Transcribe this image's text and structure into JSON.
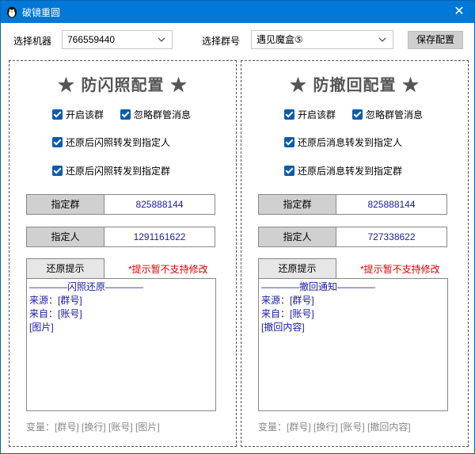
{
  "window": {
    "title": "破镜重圆",
    "close_glyph": "✕"
  },
  "toolbar": {
    "machine_label": "选择机器",
    "machine_value": "766559440",
    "group_label": "选择群号",
    "group_value": "遇见魔盒⑤",
    "save_label": "保存配置"
  },
  "left_panel": {
    "title": "★ 防闪照配置 ★",
    "checkboxes": {
      "enable": "开启该群",
      "ignore_admin": "忽略群管消息",
      "forward_person": "还原后闪照转发到指定人",
      "forward_group": "还原后闪照转发到指定群"
    },
    "target_group_label": "指定群",
    "target_group_value": "825888144",
    "target_person_label": "指定人",
    "target_person_value": "1291161622",
    "tip_label": "还原提示",
    "warning": "*提示暂不支持修改",
    "template": "————闪照还原————\n来源：[群号]\n来自：[账号]\n[图片]",
    "variables": "变量：[群号] [换行] [账号] [图片]"
  },
  "right_panel": {
    "title": "★ 防撤回配置 ★",
    "checkboxes": {
      "enable": "开启该群",
      "ignore_admin": "忽略群管消息",
      "forward_person": "还原后消息转发到指定人",
      "forward_group": "还原后消息转发到指定群"
    },
    "target_group_label": "指定群",
    "target_group_value": "825888144",
    "target_person_label": "指定人",
    "target_person_value": "727338622",
    "tip_label": "还原提示",
    "warning": "*提示暂不支持修改",
    "template": "————撤回通知————\n来源：[群号]\n来自：[账号]\n[撤回内容]",
    "variables": "变量：[群号] [换行] [账号] [撤回内容]"
  },
  "icons": {
    "app": "qq-penguin-icon",
    "dropdown": "chevron-down-icon",
    "checkbox": "checkmark-icon"
  },
  "colors": {
    "titlebar": "#0078d7",
    "checkbox": "#0b5cad",
    "value_text": "#1a1aa6",
    "warning": "#e00000"
  }
}
